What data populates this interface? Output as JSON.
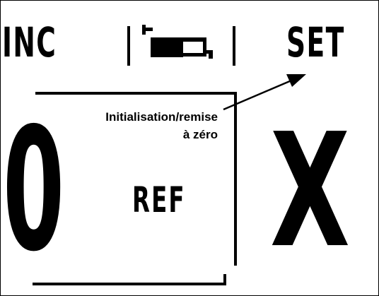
{
  "softkeys": {
    "inc_label": "INC",
    "tool_icon": "tool-icon",
    "set_label": "SET"
  },
  "annotation": {
    "line1": "Initialisation/remise",
    "line2": "à zéro"
  },
  "display": {
    "value": "0",
    "ref_label": "REF",
    "axis": "X"
  }
}
